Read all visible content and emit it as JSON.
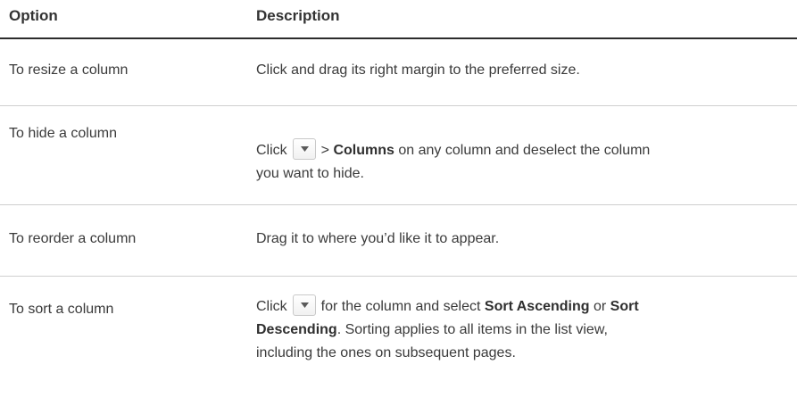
{
  "header": {
    "option": "Option",
    "description": "Description"
  },
  "rows": [
    {
      "option": "To resize a column",
      "desc": "Click and drag its right margin to the preferred size."
    },
    {
      "option": "To hide a column",
      "desc_click": "Click",
      "desc_gt": ">",
      "desc_bold": "Columns",
      "desc_rest": "on any column and deselect the column",
      "desc_line2": "you want to hide."
    },
    {
      "option": "To reorder a column",
      "desc": "Drag it to where you’d like it to appear."
    },
    {
      "option": "To sort a column",
      "desc_click": "Click",
      "desc_mid": "for the column and select",
      "desc_bold1": "Sort Ascending",
      "desc_or": "or",
      "desc_bold2_a": "Sort",
      "desc_bold2_b": "Descending",
      "desc_after": ". Sorting applies to all items in the list view,",
      "desc_line3": "including the ones on subsequent pages."
    }
  ],
  "icons": {
    "menu_button": "dropdown-arrow-icon"
  }
}
